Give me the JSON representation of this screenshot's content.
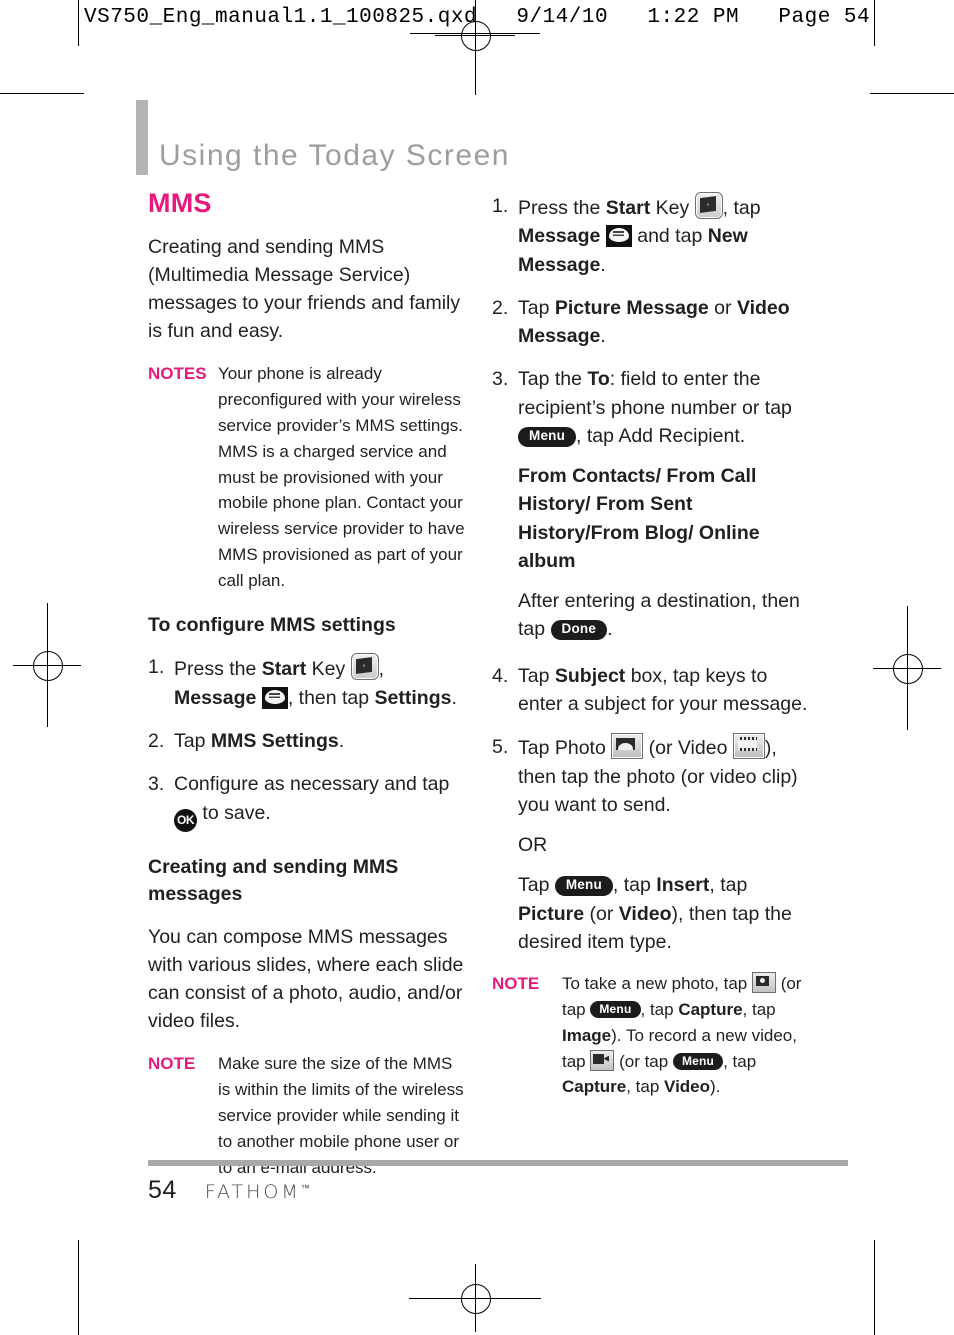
{
  "print": {
    "slug": "VS750_Eng_manual1.1_100825.qxd   9/14/10   1:22 PM   Page 54"
  },
  "chapter": {
    "title": "Using the Today Screen"
  },
  "left_column": {
    "section_title": "MMS",
    "intro": "Creating and sending MMS (Multimedia Message Service) messages to your friends and family is fun and easy.",
    "notes_block": {
      "label": "NOTES",
      "text": "Your phone is already preconfigured with your wireless service provider’s MMS settings. MMS is a charged service and must be provisioned with your mobile phone plan. Contact your wireless service provider to have MMS provisioned as part of your call plan."
    },
    "subhead_configure": "To configure MMS settings",
    "steps": [
      {
        "num": "1.",
        "part1": "Press the ",
        "bold1": "Start",
        "part2": " Key ",
        "icon1": "start-key-icon",
        "part3": ", ",
        "bold2": "Message",
        "part4": " ",
        "icon2": "message-icon",
        "part5": ", then tap ",
        "bold3": "Settings",
        "part6": "."
      },
      {
        "num": "2.",
        "part1": "Tap ",
        "bold1": "MMS Settings",
        "part2": "."
      },
      {
        "num": "3.",
        "part1": "Configure as necessary and tap ",
        "icon1": "ok-icon",
        "part2": " to save."
      }
    ],
    "subhead_creating": "Creating and sending MMS messages",
    "compose_text": "You can compose MMS messages with various slides, where each slide can consist of a photo, audio, and/or video files.",
    "note_block": {
      "label": "NOTE",
      "text": "Make sure the size of the MMS is within the limits of the wireless service provider while sending it to another mobile phone user or to an e-mail address."
    }
  },
  "right_column": {
    "steps": [
      {
        "num": "1.",
        "part1": "Press the ",
        "bold1": "Start",
        "part2": " Key ",
        "icon1": "start-key-icon",
        "part3": ", tap ",
        "bold2": "Message",
        "part4": " ",
        "icon2": "message-icon",
        "part5": " and tap ",
        "bold3": "New Message",
        "part6": "."
      },
      {
        "num": "2.",
        "part1": "Tap ",
        "bold1": "Picture Message",
        "part2": " or ",
        "bold2": "Video Message",
        "part3": "."
      },
      {
        "num": "3.",
        "part1": "Tap the ",
        "bold1": "To",
        "part2": ": field to enter the recipient’s phone number or tap ",
        "pill1": "Menu",
        "part3": ", tap Add Recipient.",
        "bold_block": "From Contacts/ From Call History/ From Sent History/From Blog/ Online album",
        "after1": "After entering a destination, then tap ",
        "pill2": "Done",
        "after2": "."
      },
      {
        "num": "4.",
        "part1": "Tap ",
        "bold1": "Subject",
        "part2": " box, tap keys to enter a subject for your message."
      },
      {
        "num": "5.",
        "part1": "Tap Photo ",
        "icon1": "photo-icon",
        "part2": " (or Video ",
        "icon2": "video-icon",
        "part3": "), then tap the photo (or video clip) you want to send.",
        "or_text": "OR",
        "alt1": "Tap ",
        "pill1": "Menu",
        "alt2": ", tap ",
        "bold2": "Insert",
        "alt3": ", tap ",
        "bold3": "Picture",
        "alt4": " (or ",
        "bold4": "Video",
        "alt5": "), then tap the desired item type."
      }
    ],
    "note_block": {
      "label": "NOTE",
      "t1": "To take a new photo, tap ",
      "icon1": "camera-icon",
      "t2": " (or tap ",
      "pill1": "Menu",
      "t3": ", tap ",
      "b1": "Capture",
      "t4": ", tap ",
      "b2": "Image",
      "t5": "). To record a new video, tap ",
      "icon2": "camcorder-icon",
      "t6": " (or tap ",
      "pill2": "Menu",
      "t7": ", tap ",
      "b3": "Capture",
      "t8": ", tap ",
      "b4": "Video",
      "t9": ")."
    }
  },
  "footer": {
    "page_number": "54",
    "brand": "FATHOM",
    "brand_tm": "™"
  },
  "colors": {
    "accent_pink": "#e6197f",
    "chapter_gray": "#9d9d9d",
    "rule_gray": "#a9a9a9",
    "text": "#231f20"
  }
}
